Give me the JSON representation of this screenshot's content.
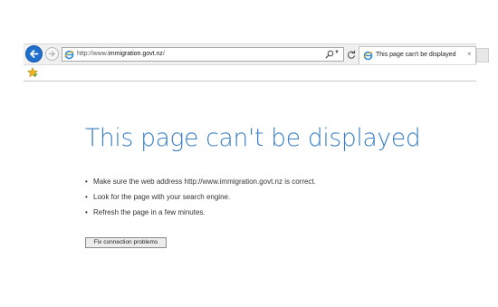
{
  "browser": {
    "address_bar": {
      "url_prefix": "http://www.",
      "url_domain": "immigration.govt.nz",
      "url_suffix": "/"
    },
    "tab": {
      "title": "This page can't be displayed",
      "close_glyph": "×"
    },
    "icons": {
      "back": "back-arrow-icon",
      "forward": "forward-arrow-icon",
      "page": "internet-explorer-icon",
      "search": "search-icon",
      "dropdown": "dropdown-icon",
      "refresh": "refresh-icon",
      "favorites": "favorites-star-icon"
    },
    "colors": {
      "back_button": "#1f6fcf",
      "title": "#3a7fc5",
      "star": "#f2b51c"
    }
  },
  "error_page": {
    "title": "This page can't be displayed",
    "tips": [
      "Make sure the web address http://www.immigration.govt.nz is correct.",
      "Look for the page with your search engine.",
      "Refresh the page in a few minutes."
    ],
    "fix_button_label": "Fix connection problems"
  }
}
